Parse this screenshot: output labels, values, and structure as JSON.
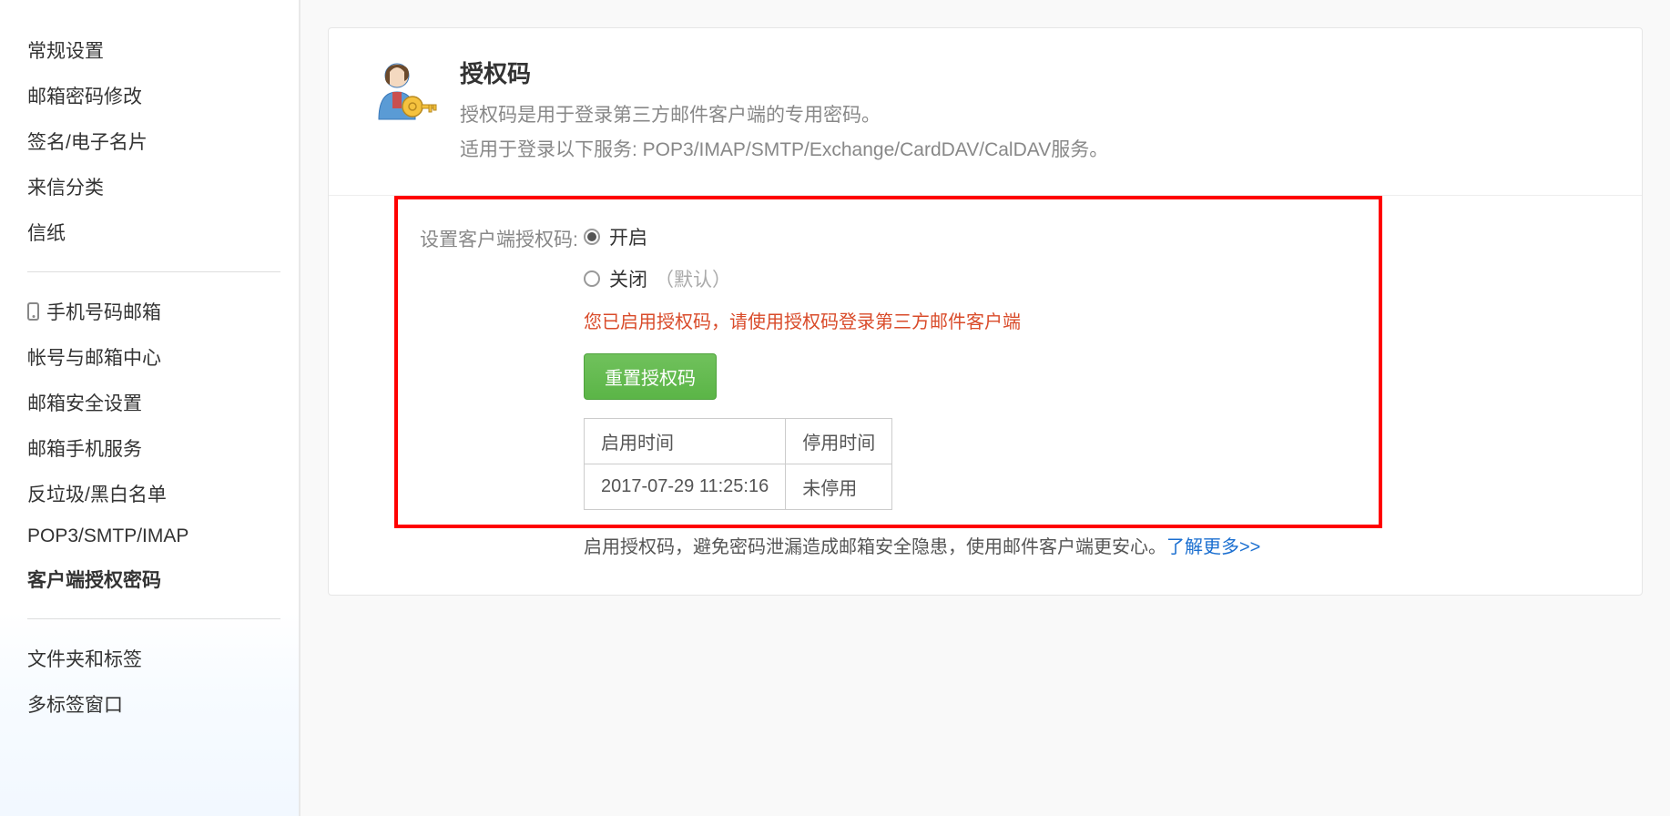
{
  "sidebar": {
    "group1": [
      "常规设置",
      "邮箱密码修改",
      "签名/电子名片",
      "来信分类",
      "信纸"
    ],
    "group2": {
      "phone": "手机号码邮箱",
      "items": [
        "帐号与邮箱中心",
        "邮箱安全设置",
        "邮箱手机服务",
        "反垃圾/黑白名单",
        "POP3/SMTP/IMAP",
        "客户端授权密码"
      ],
      "active_index": 5
    },
    "group3": [
      "文件夹和标签",
      "多标签窗口"
    ]
  },
  "card": {
    "title": "授权码",
    "desc1": "授权码是用于登录第三方邮件客户端的专用密码。",
    "desc2": "适用于登录以下服务: POP3/IMAP/SMTP/Exchange/CardDAV/CalDAV服务。"
  },
  "form": {
    "label": "设置客户端授权码:",
    "option_on": "开启",
    "option_off": "关闭",
    "option_default": "（默认）",
    "warning": "您已启用授权码，请使用授权码登录第三方邮件客户端",
    "button": "重置授权码",
    "table": {
      "th1": "启用时间",
      "th2": "停用时间",
      "td1": "2017-07-29 11:25:16",
      "td2": "未停用"
    },
    "hint": "启用授权码，避免密码泄漏造成邮箱安全隐患，使用邮件客户端更安心。",
    "hint_link": "了解更多>>"
  }
}
